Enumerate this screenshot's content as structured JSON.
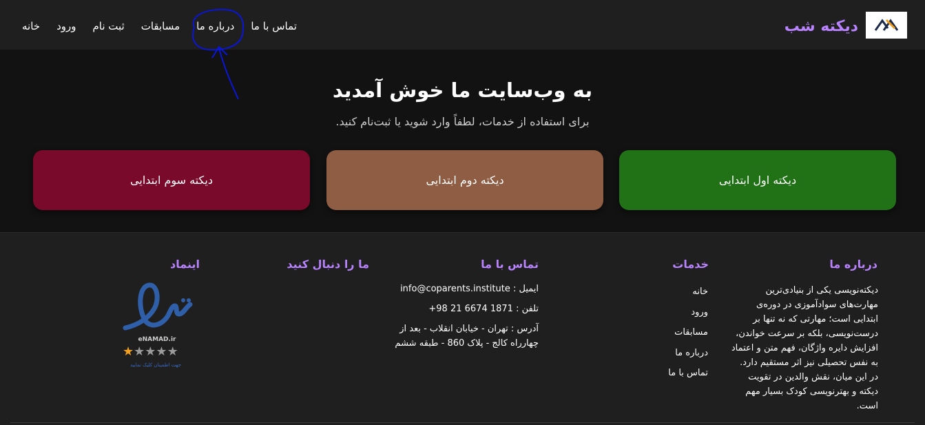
{
  "navbar": {
    "brand": "دیکته شب",
    "links": [
      "خانه",
      "ورود",
      "ثبت نام",
      "مسابقات",
      "درباره ما",
      "تماس با ما"
    ]
  },
  "hero": {
    "title": "به وب‌سایت ما خوش آمدید",
    "subtitle": "برای استفاده از خدمات، لطفاً وارد شوید یا ثبت‌نام کنید.",
    "cards": [
      "دیکته اول ابتدایی",
      "دیکته دوم ابتدایی",
      "دیکته سوم ابتدایی"
    ]
  },
  "footer": {
    "about": {
      "title": "درباره ما",
      "text": "دیکته‌نویسی یکی از بنیادی‌ترین مهارت‌های سوادآموزی در دوره‌ی ابتدایی است؛ مهارتی که نه تنها بر درست‌نویسی، بلکه بر سرعت خواندن، افزایش دایره واژگان، فهم متن و اعتماد به نفس تحصیلی نیز اثر مستقیم دارد. در این میان، نقش والدین در تقویت دیکته و بهترنویسی کودک بسیار مهم است."
    },
    "services": {
      "title": "خدمات",
      "items": [
        "خانه",
        "ورود",
        "مسابقات",
        "درباره ما",
        "تماس با ما"
      ]
    },
    "contact": {
      "title": "تماس با ما",
      "email": "ایمیل : info@coparents.institute",
      "phone": "تلفن : 1871 6674 21 98+",
      "address": "آدرس : تهران - خیابان انقلاب - بعد از چهارراه کالج - پلاک 860 - طبقه ششم"
    },
    "follow": {
      "title": "ما را دنبال کنید"
    },
    "enamad": {
      "title": "اینماد",
      "brand_word": "eNAMAD.ir",
      "caption": "جهت اطمینان کلیک نمایید",
      "rating": 1,
      "rating_max": 5
    }
  },
  "colors": {
    "accent": "#b983ff",
    "nav_bg": "#1f1f1f",
    "page_bg": "#121212",
    "card_green": "#217217",
    "card_brown": "#8f5d44",
    "card_maroon": "#7a0a2b",
    "annotation": "#0a16d8"
  }
}
